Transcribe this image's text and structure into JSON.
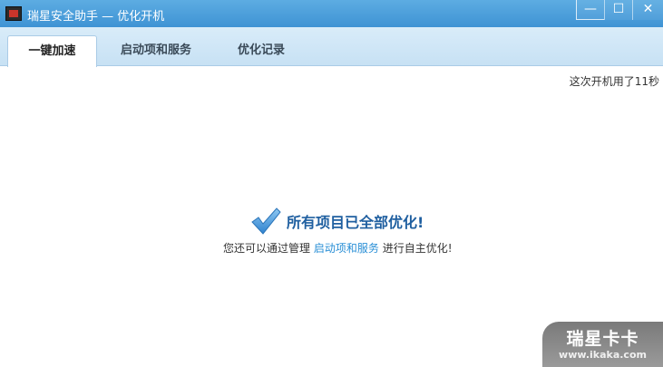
{
  "window": {
    "title": "瑞星安全助手 — 优化开机",
    "minimize": "—",
    "maximize": "☐",
    "close": "✕"
  },
  "tabs": [
    {
      "label": "一键加速",
      "active": true
    },
    {
      "label": "启动项和服务",
      "active": false
    },
    {
      "label": "优化记录",
      "active": false
    }
  ],
  "content": {
    "boot_time": "这次开机用了11秒",
    "headline": "所有项目已全部优化!",
    "sub_prefix": "您还可以通过管理",
    "sub_link": "启动项和服务",
    "sub_suffix": "进行自主优化!"
  },
  "watermark": {
    "brand": "瑞星卡卡",
    "url": "www.ikaka.com"
  },
  "colors": {
    "titlebar": "#4aa0dc",
    "headline": "#1f5fa0",
    "link": "#2a8fd6",
    "check": "#3b8fd8"
  }
}
